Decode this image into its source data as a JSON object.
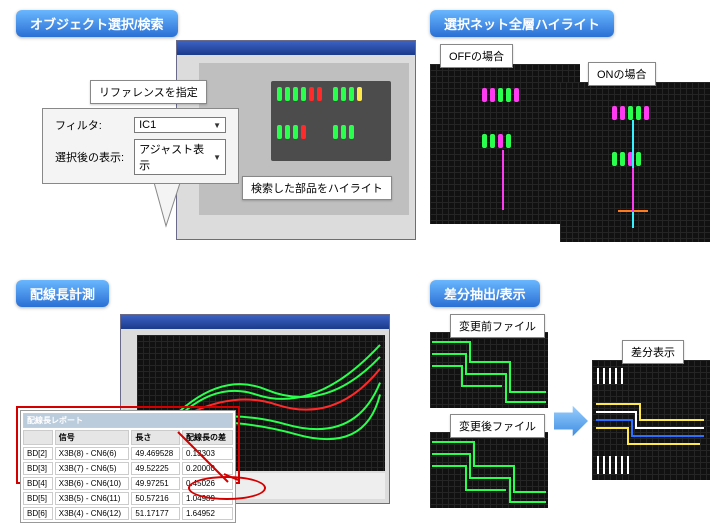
{
  "section1": {
    "title": "オブジェクト選択/検索",
    "ref_label": "リファレンスを指定",
    "filter_label": "フィルタ:",
    "filter_value": "IC1",
    "disp_label": "選択後の表示:",
    "disp_value": "アジャスト表示",
    "highlight_label": "検索した部品をハイライト"
  },
  "section2": {
    "title": "選択ネット全層ハイライト",
    "off_label": "OFFの場合",
    "on_label": "ONの場合"
  },
  "section3": {
    "title": "配線長計測",
    "report_title": "配線長レポート",
    "headers": [
      "",
      "信号",
      "長さ",
      "配線長の差"
    ],
    "rows": [
      [
        "BD[2]",
        "X3B(8) - CN6(6)",
        "49.469528",
        "0.13303"
      ],
      [
        "BD[3]",
        "X3B(7) - CN6(5)",
        "49.52225",
        "0.20000"
      ],
      [
        "BD[4]",
        "X3B(6) - CN6(10)",
        "49.97251",
        "0.45026"
      ],
      [
        "BD[5]",
        "X3B(5) - CN6(11)",
        "50.57216",
        "1.04989"
      ],
      [
        "BD[6]",
        "X3B(4) - CN6(12)",
        "51.17177",
        "1.64952"
      ]
    ]
  },
  "section4": {
    "title": "差分抽出/表示",
    "before_label": "変更前ファイル",
    "after_label": "変更後ファイル",
    "diff_label": "差分表示"
  }
}
